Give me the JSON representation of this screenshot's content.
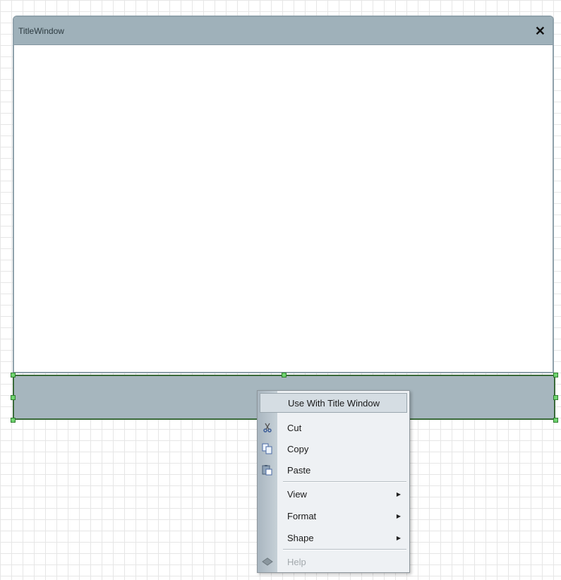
{
  "title_window": {
    "title": "TitleWindow",
    "close_label": "✕"
  },
  "context_menu": {
    "use_with": "Use With Title Window",
    "items": [
      {
        "label": "Cut",
        "mnemonic": "t",
        "icon": "scissors-icon"
      },
      {
        "label": "Copy",
        "mnemonic": "C",
        "icon": "copy-icon"
      },
      {
        "label": "Paste",
        "mnemonic": "P",
        "icon": "paste-icon"
      },
      {
        "label": "View",
        "mnemonic": "V",
        "submenu": true
      },
      {
        "label": "Format",
        "mnemonic": "o",
        "submenu": true
      },
      {
        "label": "Shape",
        "mnemonic": "e",
        "submenu": true
      },
      {
        "label": "Help",
        "mnemonic": "H",
        "disabled": true,
        "icon": "help-book-icon"
      }
    ]
  },
  "colors": {
    "titlebar": "#9fb1ba",
    "selection_handle": "#6fd46f",
    "menu_background": "#eef1f4"
  }
}
